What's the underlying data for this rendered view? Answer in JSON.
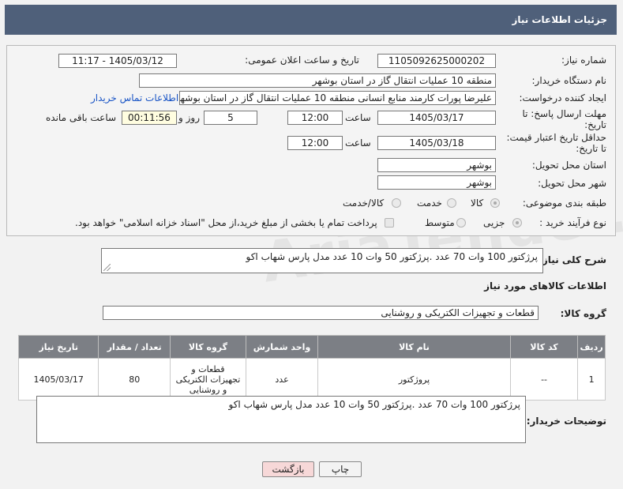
{
  "page": {
    "title": "جزئیات اطلاعات نیاز"
  },
  "form": {
    "need_number": {
      "label": "شماره نیاز:",
      "value": "1105092625000202"
    },
    "announce": {
      "label": "تاریخ و ساعت اعلان عمومی:",
      "value": "1405/03/12 - 11:17"
    },
    "buyer_org": {
      "label": "نام دستگاه خریدار:",
      "value": "منطقه 10 عملیات انتقال گاز در استان بوشهر"
    },
    "requester": {
      "label": "ایجاد کننده درخواست:",
      "value": "علیرضا پورات کارمند منابع انسانی منطقه 10 عملیات انتقال گاز در استان بوشهر",
      "contact_link": "اطلاعات تماس خریدار"
    },
    "reply_deadline": {
      "label_line1": "مهلت ارسال پاسخ: تا",
      "label_line2": "تاریخ:",
      "date": "1405/03/17",
      "time_label": "ساعت",
      "time": "12:00",
      "days": "5",
      "days_label": "روز و",
      "remaining": "00:11:56",
      "remaining_label": "ساعت باقی مانده"
    },
    "price_validity": {
      "label_line1": "حداقل تاریخ اعتبار قیمت:",
      "label_line2": "تا تاریخ:",
      "date": "1405/03/18",
      "time_label": "ساعت",
      "time": "12:00"
    },
    "province": {
      "label": "استان محل تحویل:",
      "value": "بوشهر"
    },
    "city": {
      "label": "شهر محل تحویل:",
      "value": "بوشهر"
    },
    "category": {
      "label": "طبقه بندی موضوعی:",
      "options": [
        "کالا",
        "خدمت",
        "کالا/خدمت"
      ],
      "selected": "کالا"
    },
    "process": {
      "label": "نوع فرآیند خرید :",
      "options": [
        "جزیی",
        "متوسط"
      ],
      "selected": "جزیی",
      "note": "پرداخت تمام یا بخشی از مبلغ خرید،از محل \"اسناد خزانه اسلامی\" خواهد بود."
    }
  },
  "summary": {
    "label": "شرح کلی نیاز:",
    "value": "پرژکتور 100 وات 70 عدد .پرژکتور 50 وات 10 عدد مدل پارس شهاب  اکو"
  },
  "goods_section": {
    "title": "اطلاعات کالاهای مورد نیاز",
    "group_label": "گروه کالا:",
    "group_value": "قطعات و تجهیزات الکتریکی و روشنایی"
  },
  "table": {
    "headers": [
      "ردیف",
      "کد کالا",
      "نام کالا",
      "واحد شمارش",
      "گروه کالا",
      "تعداد / مقدار",
      "تاریخ نیاز"
    ],
    "rows": [
      {
        "index": "1",
        "code": "--",
        "name": "پروژکتور",
        "unit": "عدد",
        "group": "قطعات و تجهیزات الکتریکی و روشنایی",
        "qty": "80",
        "date": "1405/03/17"
      }
    ]
  },
  "buyer_notes": {
    "label": "توضیحات خریدار:",
    "value": "پرژکتور 100 وات 70 عدد .پرژکتور 50 وات 10 عدد مدل پارس شهاب  اکو"
  },
  "buttons": {
    "print": "چاپ",
    "back": "بازگشت"
  },
  "watermark": "AriaTender.net",
  "colors": {
    "header": "#4f607a",
    "table_header": "#7c7f85",
    "link": "#1a55c6",
    "back_button": "#f7d8d8"
  }
}
